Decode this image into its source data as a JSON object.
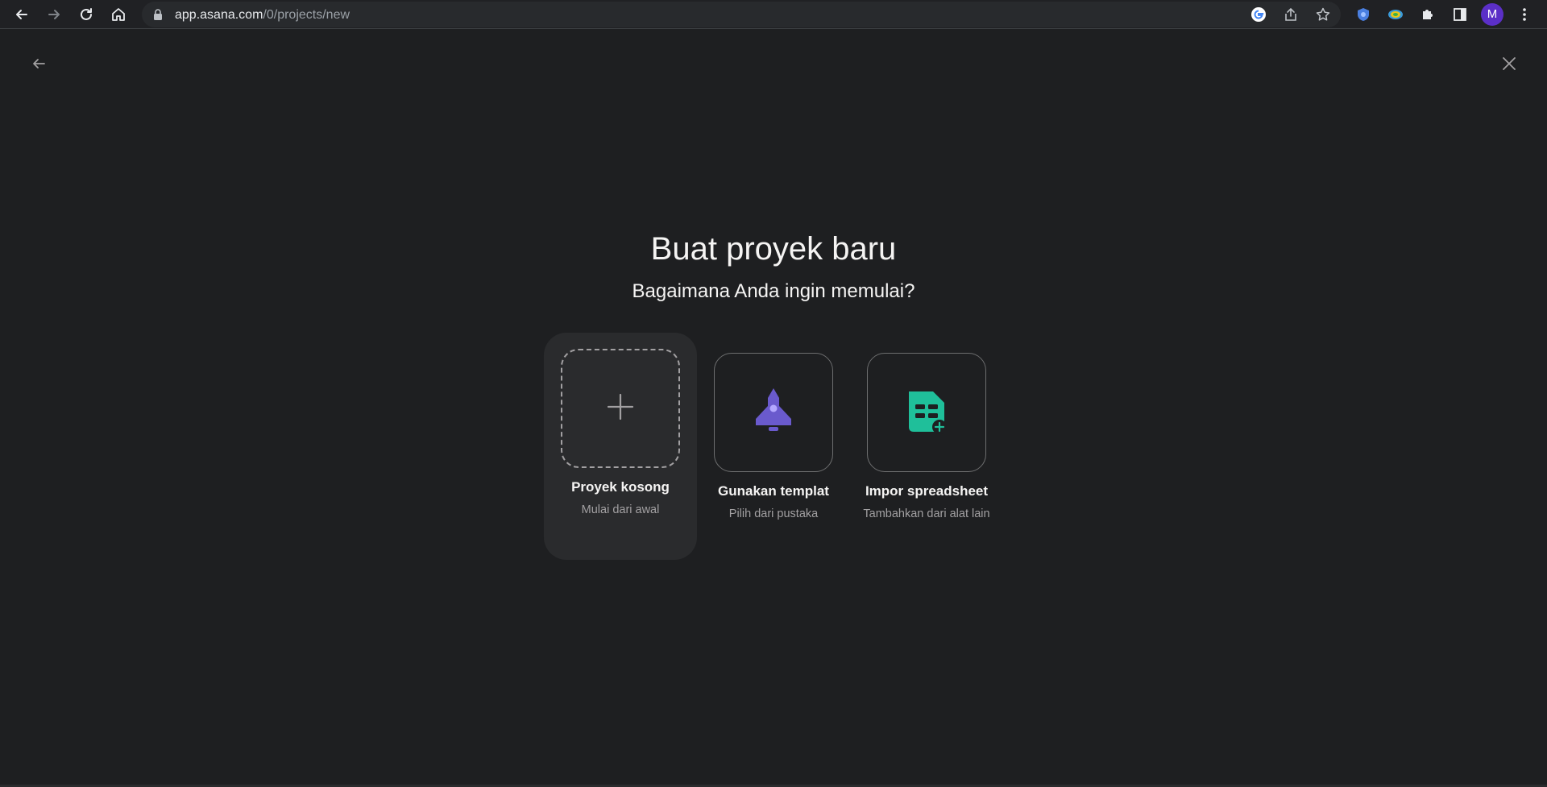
{
  "browser": {
    "url_host": "app.asana.com",
    "url_path": "/0/projects/new",
    "avatar_letter": "M",
    "icons": [
      "back-icon",
      "forward-icon",
      "reload-icon",
      "home-icon",
      "lock-icon",
      "google-icon",
      "share-icon",
      "star-icon",
      "extension-shield-icon",
      "extension-color-icon",
      "puzzle-icon",
      "side-panel-icon",
      "menu-kebab-icon"
    ]
  },
  "page": {
    "title": "Buat proyek baru",
    "subtitle": "Bagaimana Anda ingin memulai?"
  },
  "options": [
    {
      "label": "Proyek kosong",
      "description": "Mulai dari awal",
      "icon": "plus-icon",
      "selected": true
    },
    {
      "label": "Gunakan templat",
      "description": "Pilih dari pustaka",
      "icon": "rocket-icon",
      "selected": false
    },
    {
      "label": "Impor spreadsheet",
      "description": "Tambahkan dari alat lain",
      "icon": "spreadsheet-icon",
      "selected": false
    }
  ],
  "colors": {
    "background": "#1e1f21",
    "selected_card": "#2a2b2d",
    "rocket": "#6a5acd",
    "spreadsheet": "#1fbf9a",
    "avatar": "#5b2fc7"
  }
}
